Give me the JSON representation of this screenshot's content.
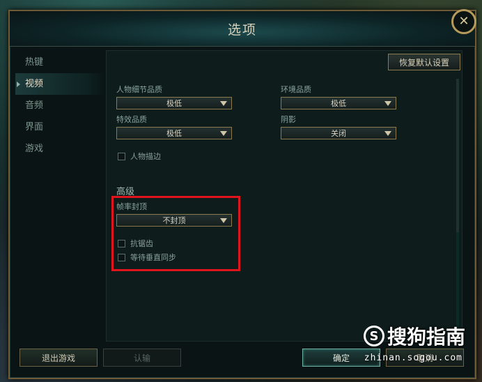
{
  "window": {
    "title": "选项"
  },
  "sidebar": {
    "items": [
      {
        "label": "热键"
      },
      {
        "label": "视频"
      },
      {
        "label": "音频"
      },
      {
        "label": "界面"
      },
      {
        "label": "游戏"
      }
    ]
  },
  "toolbar": {
    "restore_defaults": "恢复默认设置"
  },
  "settings": {
    "character_detail": {
      "label": "人物细节品质",
      "value": "极低"
    },
    "environment": {
      "label": "环境品质",
      "value": "极低"
    },
    "effects": {
      "label": "特效品质",
      "value": "极低"
    },
    "shadows": {
      "label": "阴影",
      "value": "关闭"
    },
    "character_outline": {
      "label": "人物描边"
    }
  },
  "advanced": {
    "title": "高级",
    "frame_cap": {
      "label": "帧率封顶",
      "value": "不封顶"
    },
    "anti_aliasing": {
      "label": "抗锯齿"
    },
    "vsync": {
      "label": "等待垂直同步"
    }
  },
  "footer": {
    "exit_game": "退出游戏",
    "admit": "认输",
    "ok": "确定",
    "cancel": "取消"
  },
  "watermark": {
    "brand": "搜狗指南",
    "url": "zhinan.sogou.com",
    "logo_glyph": "S"
  },
  "colors": {
    "accent_gold": "#8a7a4e",
    "highlight_red": "#e0141c",
    "active_teal": "#6fb0a2"
  }
}
